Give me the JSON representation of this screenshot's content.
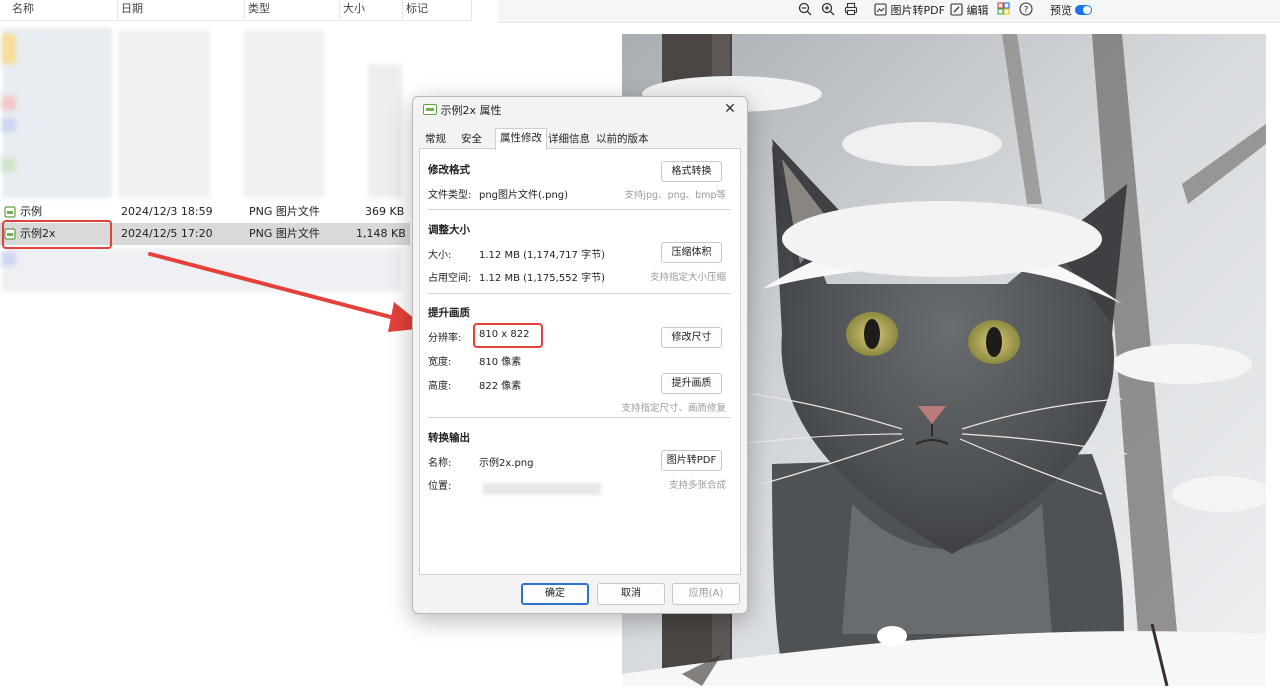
{
  "file_list": {
    "columns": [
      "名称",
      "日期",
      "类型",
      "大小",
      "标记"
    ],
    "rows": [
      {
        "name": "示例",
        "date": "2024/12/3 18:59",
        "type": "PNG 图片文件",
        "size": "369 KB"
      },
      {
        "name": "示例2x",
        "date": "2024/12/5 17:20",
        "type": "PNG 图片文件",
        "size": "1,148 KB"
      }
    ]
  },
  "viewer_toolbar": {
    "items": [
      {
        "icon": "zoom-out-icon"
      },
      {
        "icon": "zoom-in-icon"
      },
      {
        "icon": "print-icon"
      },
      {
        "icon": "image-to-pdf-icon",
        "label": "图片转PDF"
      },
      {
        "icon": "edit-icon",
        "label": "编辑"
      },
      {
        "icon": "apps-icon"
      },
      {
        "icon": "help-icon"
      }
    ],
    "preview_label": "预览",
    "preview_on": true
  },
  "dialog": {
    "title": "示例2x 属性",
    "tabs": [
      "常规",
      "安全",
      "属性修改",
      "详细信息",
      "以前的版本"
    ],
    "active_tab": "属性修改",
    "sections": {
      "format": {
        "heading": "修改格式",
        "file_type_label": "文件类型:",
        "file_type_value": "png图片文件(.png)",
        "button": "格式转换",
        "hint": "支持jpg、png、bmp等"
      },
      "size": {
        "heading": "调整大小",
        "size_label": "大小:",
        "size_value": "1.12 MB (1,174,717 字节)",
        "disk_label": "占用空间:",
        "disk_value": "1.12 MB (1,175,552 字节)",
        "button": "压缩体积",
        "hint": "支持指定大小压缩"
      },
      "quality": {
        "heading": "提升画质",
        "resolution_label": "分辨率:",
        "resolution_value": "810 x 822",
        "width_label": "宽度:",
        "width_value": "810 像素",
        "height_label": "高度:",
        "height_value": "822 像素",
        "resize_button": "修改尺寸",
        "enhance_button": "提升画质",
        "hint": "支持指定尺寸、画质修复"
      },
      "export": {
        "heading": "转换输出",
        "name_label": "名称:",
        "name_value": "示例2x.png",
        "location_label": "位置:",
        "button": "图片转PDF",
        "hint": "支持多张合成"
      }
    },
    "buttons": {
      "ok": "确定",
      "cancel": "取消",
      "apply": "应用(A)"
    }
  },
  "colors": {
    "accent": "#1a73e8",
    "highlight": "#e3413a"
  }
}
